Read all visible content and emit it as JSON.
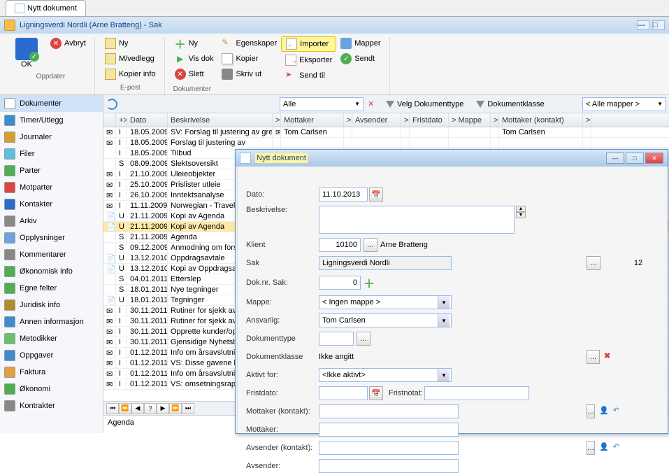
{
  "tab": {
    "label": "Nytt dokument"
  },
  "window": {
    "title": "Ligningsverdi Nordli (Arne Bratteng) - Sak"
  },
  "toolbar": {
    "ok": "OK",
    "avbryt": "Avbryt",
    "oppdater": "Oppdater",
    "ny_epost": "Ny",
    "mvedlegg": "M/vedlegg",
    "kopier_info": "Kopier info",
    "epost_label": "E-post",
    "ny_dok": "Ny",
    "vis_dok": "Vis dok",
    "slett": "Slett",
    "dokumenter_label": "Dokumenter",
    "egenskaper": "Egenskaper",
    "kopier": "Kopier",
    "skriv_ut": "Skriv ut",
    "importer": "Importer",
    "eksporter": "Eksporter",
    "send_til": "Send til",
    "mapper": "Mapper",
    "sendt": "Sendt"
  },
  "sidebar": {
    "items": [
      "Dokumenter",
      "Timer/Utlegg",
      "Journaler",
      "Filer",
      "Parter",
      "Motparter",
      "Kontakter",
      "Arkiv",
      "Opplysninger",
      "Kommentarer",
      "Økonomisk info",
      "Egne felter",
      "Juridisk info",
      "Annen informasjon",
      "Metodikker",
      "Oppgaver",
      "Faktura",
      "Økonomi",
      "Kontrakter"
    ]
  },
  "filter": {
    "alle": "Alle",
    "velg_dokumenttype": "Velg Dokumenttype",
    "dokumentklasse": "Dokumentklasse",
    "alle_mapper": "< Alle mapper >"
  },
  "grid": {
    "cols": [
      "",
      "+>",
      "Dato",
      "Beskrivelse",
      ">",
      "Mottaker",
      ">",
      "Avsender",
      ">",
      "Fristdato",
      "> Mappe",
      ">",
      "Mottaker (kontakt)",
      ">"
    ],
    "rows": [
      {
        "s": "✉",
        "t": "I",
        "date": "18.05.2009",
        "desc": "SV: Forslag til justering av grenser. Re",
        "m": "✉",
        "mottaker": "Tom Carlsen",
        "mk": "Tom Carlsen"
      },
      {
        "s": "✉",
        "t": "I",
        "date": "18.05.2009",
        "desc": "Forslag til justering av",
        "m": "",
        "mottaker": "",
        "mk": ""
      },
      {
        "s": "",
        "t": "I",
        "date": "18.05.2009",
        "desc": "Tilbud",
        "m": "",
        "mottaker": "",
        "mk": ""
      },
      {
        "s": "",
        "t": "S",
        "date": "08.09.2009",
        "desc": "Slektsoversikt",
        "m": "",
        "mottaker": "",
        "mk": ""
      },
      {
        "s": "✉",
        "t": "I",
        "date": "21.10.2009",
        "desc": "Uleieobjekter",
        "m": "",
        "mottaker": "",
        "mk": ""
      },
      {
        "s": "✉",
        "t": "I",
        "date": "25.10.2009",
        "desc": "Prislister utleie",
        "m": "",
        "mottaker": "",
        "mk": ""
      },
      {
        "s": "✉",
        "t": "I",
        "date": "26.10.2009",
        "desc": "Inntektsanalyse",
        "m": "",
        "mottaker": "",
        "mk": ""
      },
      {
        "s": "✉",
        "t": "I",
        "date": "11.11.2009",
        "desc": "Norwegian - Travel",
        "m": "",
        "mottaker": "",
        "mk": ""
      },
      {
        "s": "📄",
        "t": "U",
        "date": "21.11.2009",
        "desc": "Kopi av Agenda",
        "m": "",
        "mottaker": "",
        "mk": ""
      },
      {
        "s": "📄",
        "t": "U",
        "date": "21.11.2009",
        "desc": "Kopi av Agenda",
        "m": "",
        "mottaker": "",
        "mk": "",
        "selected": true
      },
      {
        "s": "",
        "t": "S",
        "date": "21.11.2009",
        "desc": "Agenda",
        "m": "",
        "mottaker": "",
        "mk": ""
      },
      {
        "s": "",
        "t": "S",
        "date": "09.12.2009",
        "desc": "Anmodning om forsl",
        "m": "",
        "mottaker": "",
        "mk": ""
      },
      {
        "s": "📄",
        "t": "U",
        "date": "13.12.2010",
        "desc": "Oppdragsavtale",
        "m": "",
        "mottaker": "",
        "mk": ""
      },
      {
        "s": "📄",
        "t": "U",
        "date": "13.12.2010",
        "desc": "Kopi av Oppdragsa",
        "m": "",
        "mottaker": "",
        "mk": ""
      },
      {
        "s": "",
        "t": "S",
        "date": "04.01.2011",
        "desc": "Etterslep",
        "m": "",
        "mottaker": "",
        "mk": ""
      },
      {
        "s": "",
        "t": "S",
        "date": "18.01.2011",
        "desc": "Nye tegninger",
        "m": "",
        "mottaker": "",
        "mk": ""
      },
      {
        "s": "📄",
        "t": "U",
        "date": "18.01.2011",
        "desc": "Tegninger",
        "m": "",
        "mottaker": "",
        "mk": ""
      },
      {
        "s": "✉",
        "t": "I",
        "date": "30.11.2011",
        "desc": "Rutiner for sjekk av",
        "m": "",
        "mottaker": "",
        "mk": ""
      },
      {
        "s": "✉",
        "t": "I",
        "date": "30.11.2011",
        "desc": "Rutiner for sjekk av",
        "m": "",
        "mottaker": "",
        "mk": ""
      },
      {
        "s": "✉",
        "t": "I",
        "date": "30.11.2011",
        "desc": "Opprette kunder/op",
        "m": "",
        "mottaker": "",
        "mk": ""
      },
      {
        "s": "✉",
        "t": "I",
        "date": "30.11.2011",
        "desc": "Gjensidige Nyhetsb",
        "m": "",
        "mottaker": "",
        "mk": ""
      },
      {
        "s": "✉",
        "t": "I",
        "date": "01.12.2011",
        "desc": "Info om årsavslutni",
        "m": "",
        "mottaker": "",
        "mk": ""
      },
      {
        "s": "✉",
        "t": "I",
        "date": "01.12.2011",
        "desc": "VS: Disse gavene k",
        "m": "",
        "mottaker": "",
        "mk": ""
      },
      {
        "s": "✉",
        "t": "I",
        "date": "01.12.2011",
        "desc": "Info om årsavslutni",
        "m": "",
        "mottaker": "",
        "mk": ""
      },
      {
        "s": "✉",
        "t": "I",
        "date": "01.12.2011",
        "desc": "VS: omsetningsrap",
        "m": "",
        "mottaker": "",
        "mk": ""
      }
    ]
  },
  "detail": {
    "current": "Agenda"
  },
  "modal": {
    "title": "Nytt dokument",
    "dato_lbl": "Dato:",
    "dato_val": "11.10.2013",
    "beskrivelse_lbl": "Beskrivelse:",
    "beskrivelse_val": "",
    "klient_lbl": "Klient",
    "klient_id": "10100",
    "klient_navn": "Arne Bratteng",
    "sak_lbl": "Sak",
    "sak_navn": "Ligningsverdi Nordli",
    "sak_nr": "12",
    "doknr_lbl": "Dok.nr. Sak:",
    "doknr_val": "0",
    "mappe_lbl": "Mappe:",
    "mappe_val": "< Ingen mappe >",
    "ansvarlig_lbl": "Ansvarlig:",
    "ansvarlig_val": "Tom Carlsen",
    "doktype_lbl": "Dokumenttype",
    "doktype_val": "",
    "dokklasse_lbl": "Dokumentklasse",
    "dokklasse_val": "Ikke angitt",
    "aktivt_lbl": "Aktivt for:",
    "aktivt_val": "<Ikke aktivt>",
    "fristdato_lbl": "Fristdato:",
    "fristdato_val": "",
    "fristnotat_lbl": "Fristnotat:",
    "mottaker_kontakt_lbl": "Mottaker (kontakt):",
    "mottaker_kontakt_val": "",
    "mottaker_lbl": "Mottaker:",
    "mottaker_val": "",
    "avsender_kontakt_lbl": "Avsender (kontakt):",
    "avsender_kontakt_val": "",
    "avsender_lbl": "Avsender:",
    "avsender_val": ""
  }
}
